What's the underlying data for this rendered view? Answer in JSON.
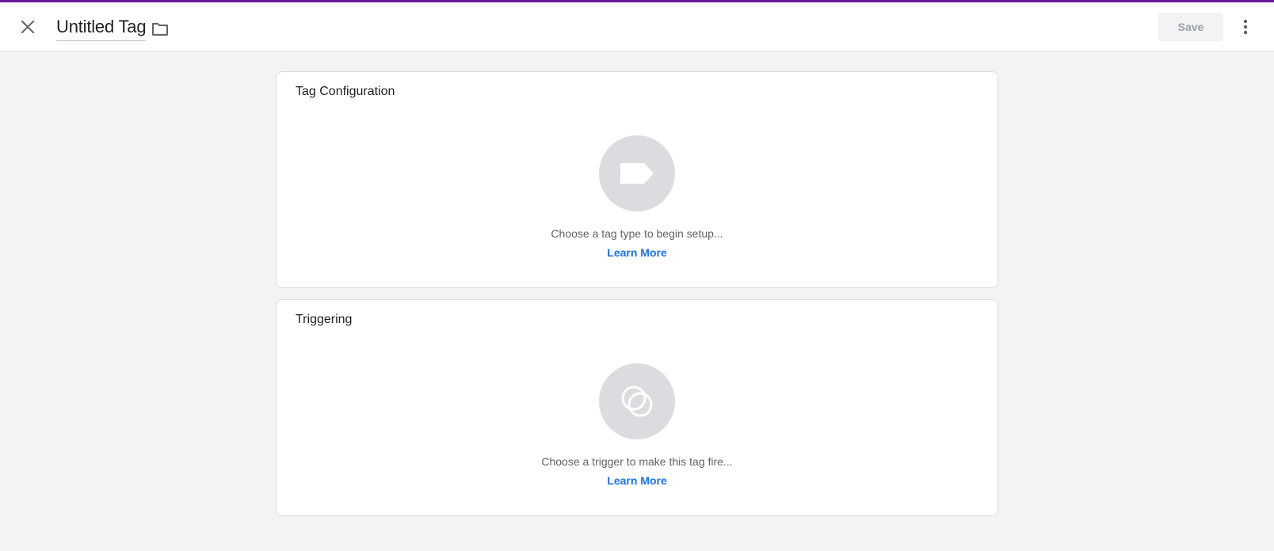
{
  "header": {
    "title": "Untitled Tag",
    "save_label": "Save",
    "accent_color": "#6a1b9a",
    "icons": {
      "close": "close-icon",
      "folder": "folder-icon",
      "more": "more-vert-icon"
    }
  },
  "sections": {
    "tag_configuration": {
      "title": "Tag Configuration",
      "hint": "Choose a tag type to begin setup...",
      "link": "Learn More",
      "icon": "tag-icon"
    },
    "triggering": {
      "title": "Triggering",
      "hint": "Choose a trigger to make this tag fire...",
      "link": "Learn More",
      "icon": "trigger-icon"
    }
  },
  "colors": {
    "link": "#1a73e8",
    "background": "#f1f3f4"
  }
}
